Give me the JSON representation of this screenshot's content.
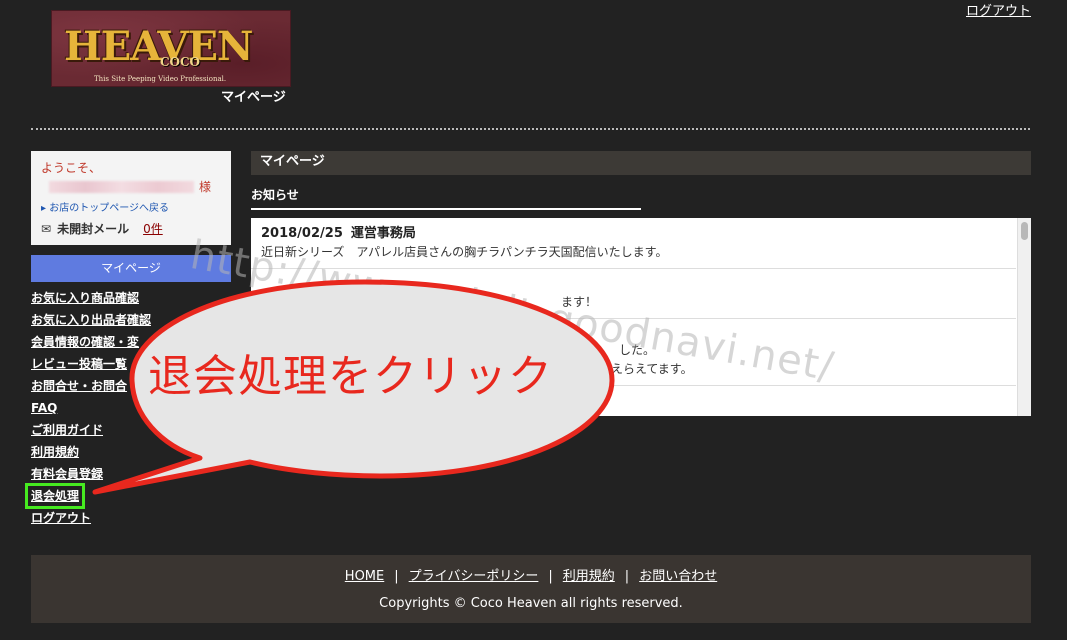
{
  "header": {
    "logout": "ログアウト",
    "logo_main": "HEAVEN",
    "logo_sub": "COCO",
    "logo_tagline": "This Site Peeping Video Professional.",
    "mypage_label": "マイページ"
  },
  "welcome": {
    "greeting": "ようこそ、",
    "honorific": "様",
    "back_link": "お店のトップページへ戻る",
    "mail_label": "未開封メール",
    "mail_count": "0件"
  },
  "sidebar": {
    "title": "マイページ",
    "items": [
      {
        "label": "お気に入り商品確認"
      },
      {
        "label": "お気に入り出品者確認"
      },
      {
        "label": "会員情報の確認・変"
      },
      {
        "label": "レビュー投稿一覧"
      },
      {
        "label": "お問合せ・お問合"
      },
      {
        "label": "FAQ"
      },
      {
        "label": "ご利用ガイド"
      },
      {
        "label": "利用規約"
      },
      {
        "label": "有料会員登録"
      },
      {
        "label": "退会処理"
      },
      {
        "label": "ログアウト"
      }
    ]
  },
  "main": {
    "title": "マイページ",
    "news_title": "お知らせ",
    "news": [
      {
        "date": "2018/02/25",
        "from": "運営事務局",
        "body": "近日新シリーズ　アパレル店員さんの胸チラパンチラ天国配信いたします。"
      },
      {
        "date": "",
        "from": "",
        "body": "ます！"
      },
      {
        "date": "",
        "from": "",
        "body": "した。"
      },
      {
        "date": "",
        "from": "",
        "body": "えらえてます。"
      }
    ]
  },
  "footer": {
    "links": [
      "HOME",
      "プライバシーポリシー",
      "利用規約",
      "お問い合わせ"
    ],
    "separator": "|",
    "copyright": "Copyrights © Coco Heaven all rights reserved."
  },
  "overlay": {
    "watermark": "http://www.adult-goodnavi.net/",
    "callout": "退会処理をクリック"
  },
  "colors": {
    "background": "#222222",
    "sidebar_title": "#5f7be0",
    "callout_border": "#e8281e",
    "callout_fill": "#e6e6e6",
    "highlight": "#46ea20"
  }
}
